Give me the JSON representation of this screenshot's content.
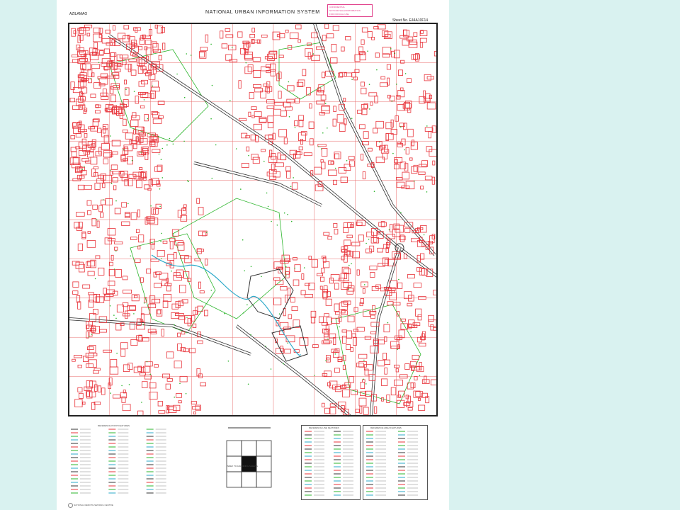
{
  "map": {
    "title": "NATIONAL URBAN INFORMATION SYSTEM",
    "place_name": "AZILAMAO",
    "sheet_no": "Sheet No. E44A10F14",
    "stamp_lines": [
      "CONFIDENTIAL",
      "NOT FOR SALE/DISTRIBUTION",
      "FOR OFFICIAL USE"
    ],
    "colors": {
      "background": "#d9f2f0",
      "sheet": "#ffffff",
      "buildings": "#e8333a",
      "vegetation": "#2bb52b",
      "water": "#2aa9c9",
      "frame": "#222222",
      "grid": "#e86a6a",
      "stamp": "#e0408a"
    },
    "legend_titles": {
      "left": "REFERENCE POINT FEATURES",
      "scale_index": "INDEX TO ADJOINING SHEETS",
      "right_1": "REFERENCE LINE FEATURES",
      "right_2": "REFERENCE AREA FEATURES"
    },
    "footer_text": "NATIONAL REMOTE SENSING CENTRE"
  }
}
